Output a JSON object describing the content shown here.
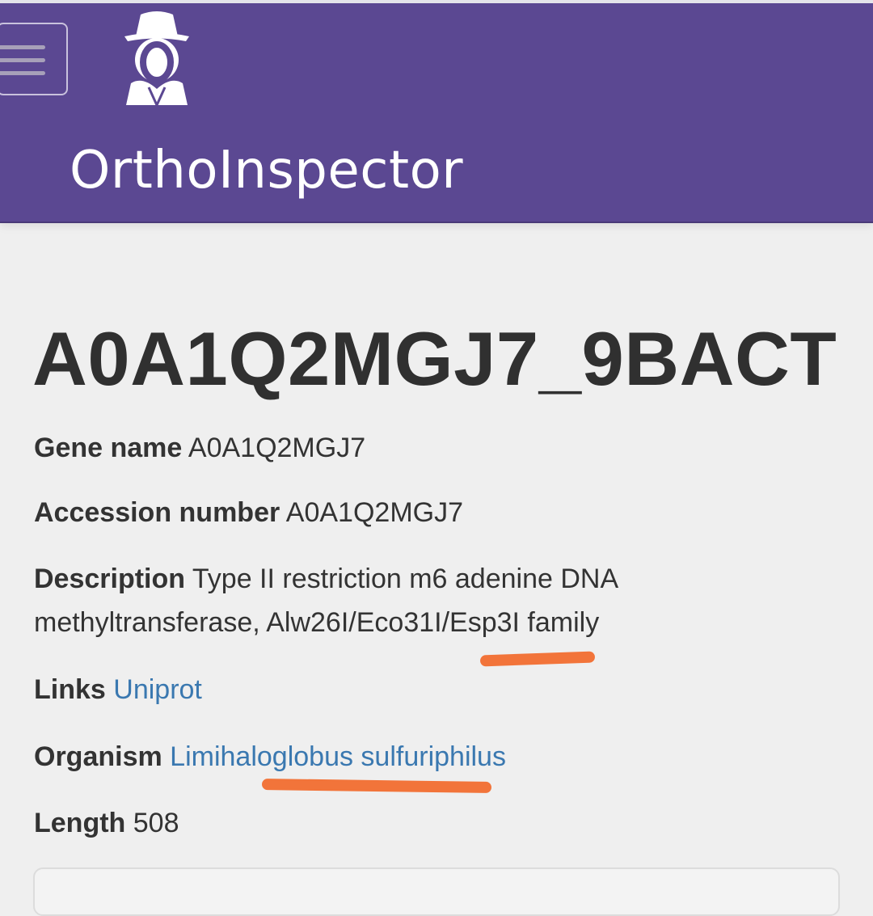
{
  "header": {
    "brand": "OrthoInspector",
    "menu_icon": "hamburger-menu-icon",
    "logo_icon": "detective-logo-icon",
    "bg_color": "#5b4892"
  },
  "protein": {
    "title": "A0A1Q2MGJ7_9BACT",
    "gene_name": {
      "label": "Gene name",
      "value": "A0A1Q2MGJ7"
    },
    "accession": {
      "label": "Accession number",
      "value": "A0A1Q2MGJ7"
    },
    "description": {
      "label": "Description",
      "line1": "Type II restriction m6 adenine DNA",
      "line2": "methyltransferase, Alw26I/Eco31I/Esp3I family"
    },
    "links": {
      "label": "Links",
      "value": "Uniprot"
    },
    "organism": {
      "label": "Organism",
      "value": "Limihaloglobus sulfuriphilus"
    },
    "length": {
      "label": "Length",
      "value": "508"
    }
  },
  "annotation_color": "#f2743a"
}
